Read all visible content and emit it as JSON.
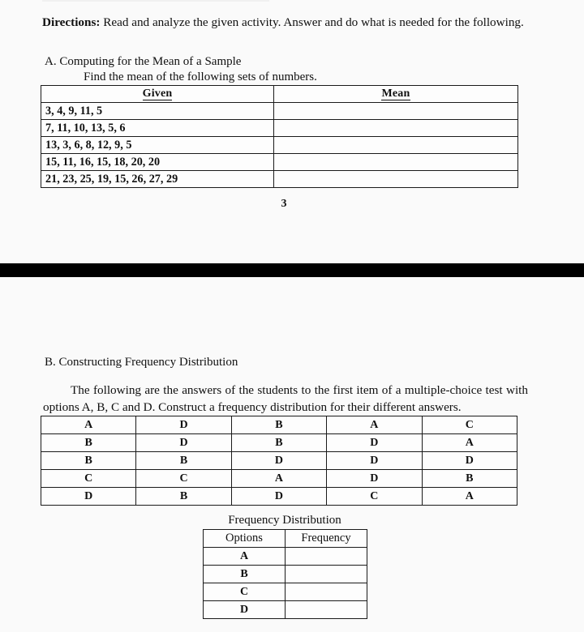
{
  "directions": {
    "lead": "Directions:",
    "text": " Read and analyze the given activity. Answer and do what is needed for the following."
  },
  "section_a": {
    "title": "A. Computing for the Mean of a Sample",
    "instruction": "Find the mean of the following sets of numbers.",
    "table": {
      "headers": [
        "Given",
        "Mean"
      ],
      "rows": [
        {
          "given": "3, 4, 9, 11, 5",
          "mean": ""
        },
        {
          "given": "7, 11, 10, 13, 5, 6",
          "mean": ""
        },
        {
          "given": "13, 3, 6, 8, 12, 9, 5",
          "mean": ""
        },
        {
          "given": "15, 11, 16, 15, 18, 20, 20",
          "mean": ""
        },
        {
          "given": "21, 23, 25, 19, 15, 26, 27, 29",
          "mean": ""
        }
      ]
    }
  },
  "page_number": "3",
  "section_b": {
    "title": "B. Constructing Frequency Distribution",
    "body": "The following are the answers of the students to the first item of a multiple-choice test with options A, B, C and D. Construct a frequency distribution for their different answers.",
    "answers_grid": [
      [
        "A",
        "D",
        "B",
        "A",
        "C"
      ],
      [
        "B",
        "D",
        "B",
        "D",
        "A"
      ],
      [
        "B",
        "B",
        "D",
        "D",
        "D"
      ],
      [
        "C",
        "C",
        "A",
        "D",
        "B"
      ],
      [
        "D",
        "B",
        "D",
        "C",
        "A"
      ]
    ],
    "frequency_distribution": {
      "caption": "Frequency Distribution",
      "headers": [
        "Options",
        "Frequency"
      ],
      "rows": [
        {
          "option": "A",
          "frequency": ""
        },
        {
          "option": "B",
          "frequency": ""
        },
        {
          "option": "C",
          "frequency": ""
        },
        {
          "option": "D",
          "frequency": ""
        }
      ]
    }
  },
  "colors": {
    "page_background": "#fafafa",
    "text": "#101010",
    "rule": "#1a1a1a",
    "separator_band": "#000000"
  }
}
